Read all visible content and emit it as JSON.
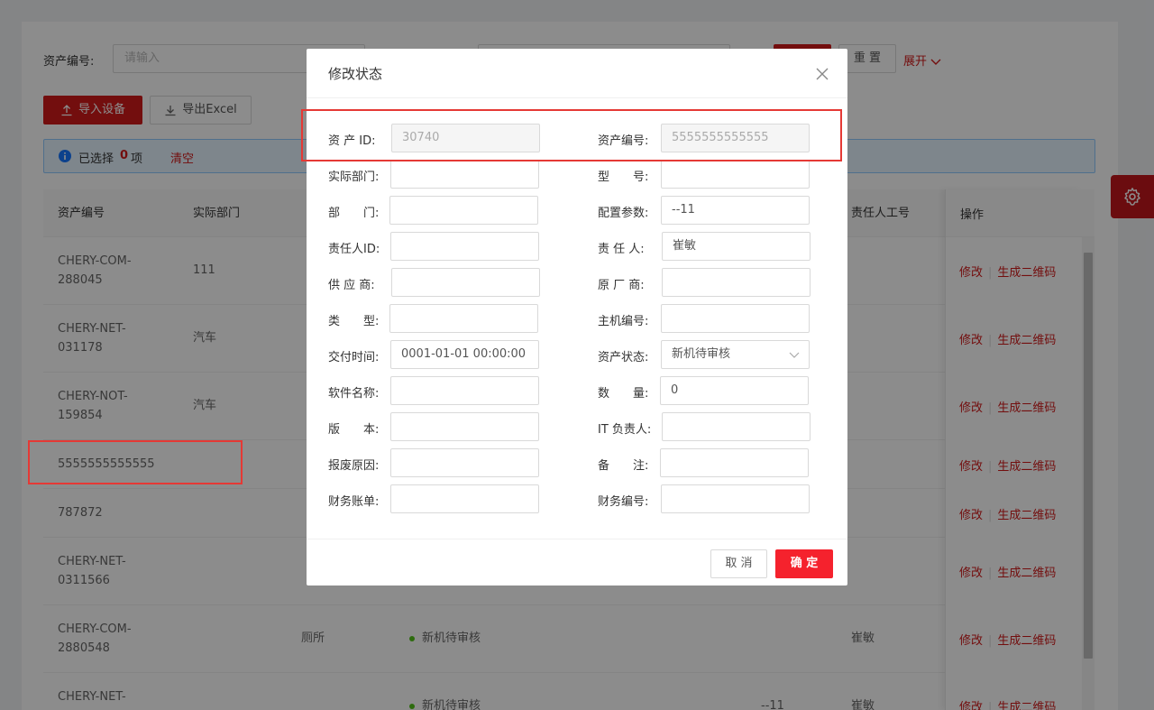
{
  "filters": {
    "asset_no_label": "资产编号:",
    "asset_no_placeholder": "请输入",
    "reset_label": "重 置",
    "expand_label": "展开"
  },
  "toolbar": {
    "import_label": "导入设备",
    "export_label": "导出Excel"
  },
  "selection": {
    "prefix": "已选择",
    "count": "0",
    "suffix": "项",
    "clear_label": "清空"
  },
  "table": {
    "headers": {
      "asset_no": "资产编号",
      "dept": "实际部门",
      "owner_no": "责任人工号",
      "ops": "操作"
    },
    "rows": [
      {
        "asset_no": "CHERY-COM-288045",
        "dept": "111",
        "col3": "",
        "status": "",
        "col5": "",
        "owner": ""
      },
      {
        "asset_no": "CHERY-NET-031178",
        "dept": "汽车",
        "col3": "",
        "status": "",
        "col5": "",
        "owner": ""
      },
      {
        "asset_no": "CHERY-NOT-159854",
        "dept": "汽车",
        "col3": "",
        "status": "",
        "col5": "",
        "owner": ""
      },
      {
        "asset_no": "5555555555555",
        "dept": "",
        "col3": "",
        "status": "",
        "col5": "",
        "owner": ""
      },
      {
        "asset_no": "787872",
        "dept": "",
        "col3": "",
        "status": "",
        "col5": "",
        "owner": ""
      },
      {
        "asset_no": "CHERY-NET-0311566",
        "dept": "",
        "col3": "",
        "status": "",
        "col5": "",
        "owner": ""
      },
      {
        "asset_no": "CHERY-COM-2880548",
        "dept": "",
        "col3": "厕所",
        "status": "新机待审核",
        "col5": "",
        "owner": "崔敏"
      },
      {
        "asset_no": "CHERY-NET-",
        "dept": "",
        "col3": "",
        "status": "新机待审核",
        "col5": "--11",
        "owner": "崔敏"
      }
    ],
    "op_edit": "修改",
    "op_qr": "生成二维码"
  },
  "modal": {
    "title": "修改状态",
    "fields": {
      "asset_id": {
        "label": "资 产 ID:",
        "value": "30740"
      },
      "asset_no": {
        "label": "资产编号:",
        "value": "5555555555555"
      },
      "actual_dept": {
        "label": "实际部门:",
        "value": ""
      },
      "model": {
        "label": "型　　号:",
        "value": ""
      },
      "dept": {
        "label": "部　　门:",
        "value": ""
      },
      "config": {
        "label": "配置参数:",
        "value": "--11"
      },
      "owner_id": {
        "label": "责任人ID:",
        "value": ""
      },
      "owner": {
        "label": "责 任 人:",
        "value": "崔敏"
      },
      "supplier": {
        "label": "供 应 商:",
        "value": ""
      },
      "manufacturer": {
        "label": "原 厂 商:",
        "value": ""
      },
      "type": {
        "label": "类　　型:",
        "value": ""
      },
      "host_no": {
        "label": "主机编号:",
        "value": ""
      },
      "delivery_time": {
        "label": "交付时间:",
        "value": "0001-01-01 00:00:00"
      },
      "asset_status": {
        "label": "资产状态:",
        "value": "新机待审核"
      },
      "software": {
        "label": "软件名称:",
        "value": ""
      },
      "quantity": {
        "label": "数　　量:",
        "value": "0"
      },
      "version": {
        "label": "版　　本:",
        "value": ""
      },
      "it_owner": {
        "label": "IT 负责人:",
        "value": ""
      },
      "scrap_reason": {
        "label": "报废原因:",
        "value": ""
      },
      "remark": {
        "label": "备　　注:",
        "value": ""
      },
      "finance_bill": {
        "label": "财务账单:",
        "value": ""
      },
      "finance_no": {
        "label": "财务编号:",
        "value": ""
      }
    },
    "cancel_label": "取 消",
    "ok_label": "确 定"
  },
  "colors": {
    "accent": "#d21a1a",
    "highlight": "#e53935",
    "status_dot": "#52c41a"
  }
}
